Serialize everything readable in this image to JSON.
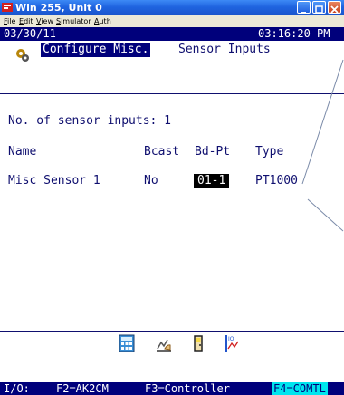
{
  "window": {
    "title": "Win 255, Unit 0",
    "controls": [
      "minimize-icon",
      "maximize-icon",
      "close-icon"
    ]
  },
  "menu": {
    "items": [
      {
        "label": "File",
        "accel": "F",
        "rest": "ile"
      },
      {
        "label": "Edit",
        "accel": "E",
        "rest": "dit"
      },
      {
        "label": "View",
        "accel": "V",
        "rest": "iew"
      },
      {
        "label": "Simulator",
        "accel": "S",
        "rest": "imulator"
      },
      {
        "label": "Auth",
        "accel": "A",
        "rest": "uth"
      }
    ]
  },
  "status": {
    "date": "03/30/11",
    "time": "03:16:20 PM"
  },
  "screen": {
    "icon": "gear-icon",
    "title_highlight": "Configure Misc.",
    "title_rest": "Sensor Inputs"
  },
  "sensors": {
    "count_label": "No. of sensor inputs: 1",
    "headers": {
      "name": "Name",
      "bcast": "Bcast",
      "bdpt": "Bd-Pt",
      "type": "Type"
    },
    "rows": [
      {
        "name": "Misc Sensor 1",
        "bcast": "No",
        "bdpt": "01-1",
        "type": "PT1000"
      }
    ]
  },
  "toolbar": {
    "icons": [
      "calculator-icon",
      "graph-hand-icon",
      "door-icon",
      "io-trend-icon"
    ]
  },
  "fkeys": {
    "io": "I/O:",
    "f2": "F2=AK2CM",
    "f3": "F3=Controller",
    "f4": "F4=COMTL"
  },
  "colors": {
    "title_bar": "#1f64e0",
    "terminal_bar": "#00007b",
    "text": "#0f0f6f",
    "f4_highlight": "#00e5ee"
  }
}
